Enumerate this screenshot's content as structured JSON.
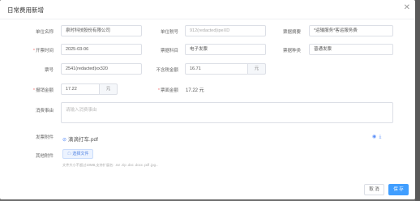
{
  "dialog": {
    "title": "日常费用新增",
    "close_icon": "close-icon"
  },
  "form": {
    "unit_name": {
      "label": "单位名称",
      "value": "泉时科技股份有限公司"
    },
    "tax_no": {
      "label": "单位税号",
      "value": "912(redacted)ipeXD"
    },
    "summary": {
      "label": "票据摘要",
      "value": "*运输服务*客运服务费"
    },
    "invoice_date": {
      "label": "开票时间",
      "value": "2025-03-06",
      "required": "*"
    },
    "category": {
      "label": "票据科目",
      "value": "电子发票"
    },
    "type": {
      "label": "票据种类",
      "value": "普通发票"
    },
    "invoice_no": {
      "label": "票号",
      "value": "2541(redacted)xx320"
    },
    "pretax": {
      "label": "不含税金额",
      "value": "16.71",
      "unit": "元"
    },
    "reimb": {
      "label": "报销金额",
      "value": "17.22",
      "unit": "元",
      "required": "*"
    },
    "invoice_amount": {
      "label": "票面金额",
      "value": "17.22 元",
      "required": "*"
    },
    "reason": {
      "label": "消费事由",
      "placeholder": "请输入消费事由"
    },
    "invoice_file": {
      "label": "发票附件",
      "filename": "滴滴打车.pdf",
      "clip_icon": "paperclip-icon",
      "view_icon": "eye-icon",
      "download_icon": "download-icon"
    },
    "other_files": {
      "label": "其他附件",
      "button": "选择文件",
      "upload_icon": "upload-icon",
      "hint": "文件大小不超过10MB,支持扩展名: .rar .zip .doc .docx .pdf .jpg..."
    }
  },
  "footer": {
    "cancel": "取 消",
    "save": "保 存"
  }
}
